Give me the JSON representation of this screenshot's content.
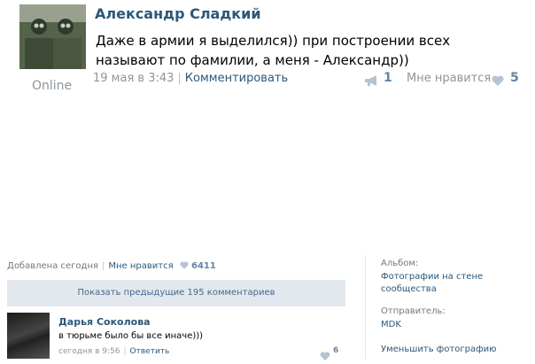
{
  "post": {
    "author": "Александр Сладкий",
    "online": "Online",
    "text": "Даже в армии я выделился)) при построении всех называют по фамилии, а меня - Александр))",
    "date": "19 мая в 3:43",
    "separator": "|",
    "comment_link": "Комментировать",
    "repost_icon": "megaphone-icon",
    "repost_count": "1",
    "like_label": "Мне нравится",
    "like_icon": "heart-icon",
    "like_count": "5"
  },
  "photo": {
    "added": "Добавлена сегодня",
    "separator": "|",
    "like_label": "Мне нравится",
    "like_count": "6411",
    "show_previous": "Показать предыдущие 195 комментариев",
    "comment": {
      "author": "Дарья Соколова",
      "text": "в тюрьме было бы все иначе)))",
      "time": "сегодня в 9:56",
      "separator": "|",
      "reply": "Ответить",
      "likes": "6"
    },
    "side": {
      "album_label": "Альбом:",
      "album_value": "Фотографии на стене сообщества",
      "sender_label": "Отправитель:",
      "sender_value": "MDK",
      "shrink": "Уменьшить фотографию"
    }
  },
  "colors": {
    "link": "#2b587a",
    "muted": "#8d959c",
    "count": "#6384a4",
    "button_bg": "#e3e8ee"
  }
}
